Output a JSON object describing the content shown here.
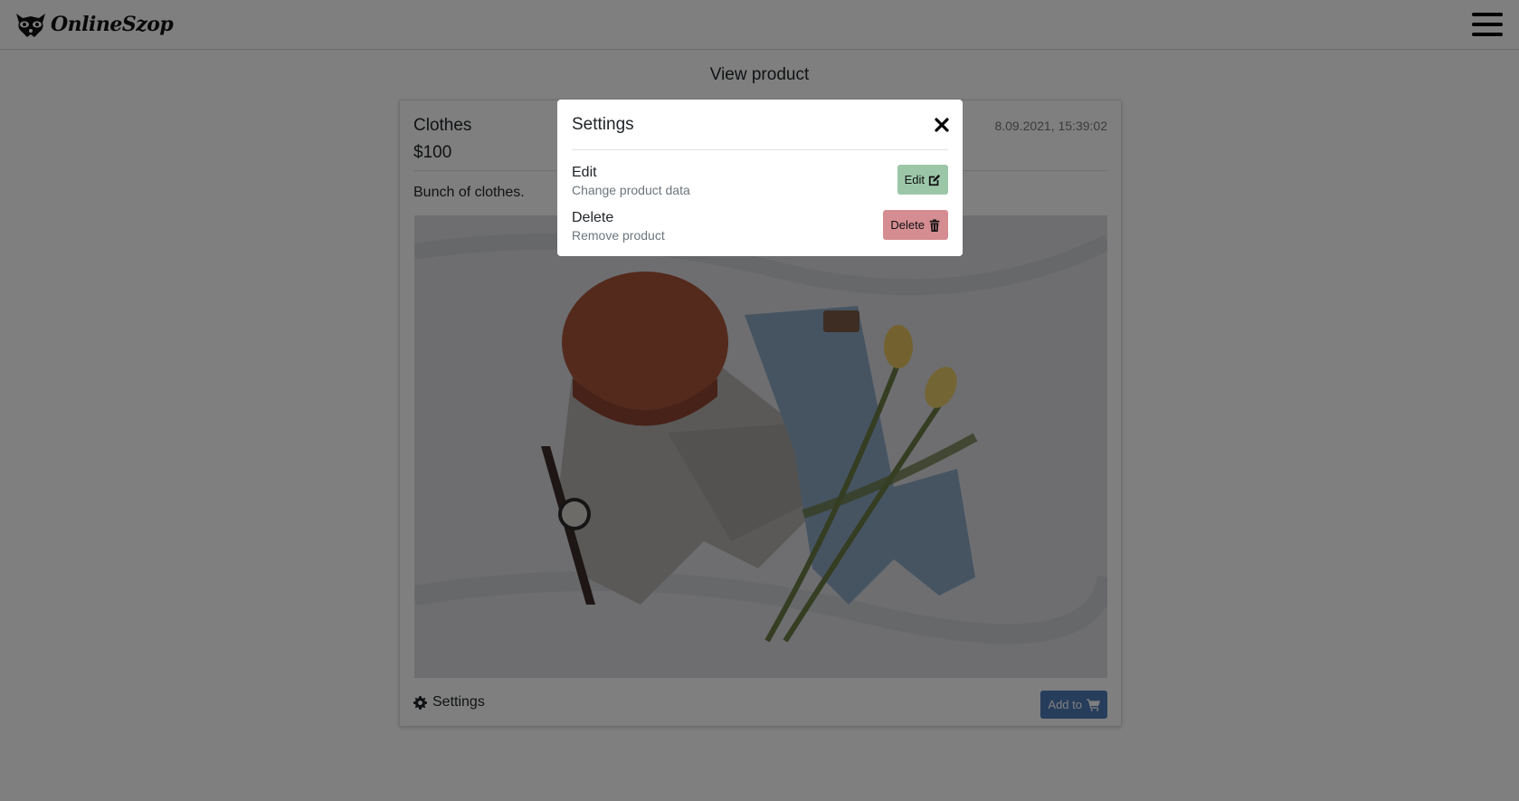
{
  "navbar": {
    "brand": "OnlineSzop",
    "logo_icon": "raccoon-icon",
    "menu_icon": "hamburger-icon"
  },
  "page": {
    "title": "View product"
  },
  "product": {
    "name": "Clothes",
    "price": "$100",
    "date": "8.09.2021, 15:39:02",
    "description": "Bunch of clothes.",
    "image_alt": "flat lay of knit beanie, grey sweater, jeans, wristwatch and yellow tulips",
    "settings_label": "Settings",
    "settings_icon": "gear-icon",
    "add_label": "Add to",
    "add_icon": "cart-icon"
  },
  "modal": {
    "title": "Settings",
    "close_icon": "close-icon",
    "options": [
      {
        "title": "Edit",
        "subtitle": "Change product data",
        "button": "Edit",
        "icon": "edit-icon",
        "color": "#9bc7a8"
      },
      {
        "title": "Delete",
        "subtitle": "Remove product",
        "button": "Delete",
        "icon": "trash-icon",
        "color": "#d58d92"
      }
    ]
  }
}
